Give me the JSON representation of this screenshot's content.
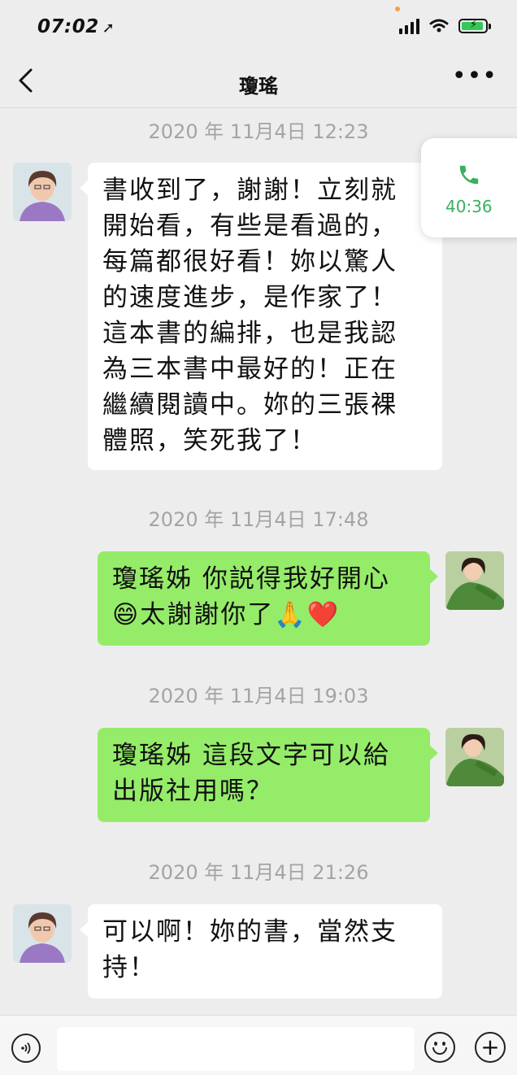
{
  "status_bar": {
    "time": "07:02",
    "location_arrow": "➚",
    "wifi_icon": "wifi-icon",
    "battery_state": "charging"
  },
  "nav": {
    "back_label": "‹",
    "title": "瓊瑤",
    "more_label": "•••"
  },
  "call_widget": {
    "duration": "40:36",
    "icon": "phone-icon",
    "color": "#38b15f"
  },
  "messages": [
    {
      "timestamp": "2020 年 11月4日 12:23",
      "side": "left",
      "lines": [
        "書收到了，謝謝！立刻就",
        "開始看，有些是看過的，",
        "每篇都很好看！妳以驚人",
        "的速度進步，是作家了！",
        "這本書的編排，也是我認",
        "為三本書中最好的！正在",
        "繼續閱讀中。妳的三張裸",
        "體照，笑死我了！"
      ]
    },
    {
      "timestamp": "2020 年 11月4日 17:48",
      "side": "right",
      "lines": [
        "瓊瑤姊 你説得我好開心",
        "😄太謝謝你了🙏❤️"
      ]
    },
    {
      "timestamp": "2020 年 11月4日 19:03",
      "side": "right",
      "lines": [
        "瓊瑤姊 這段文字可以給",
        "出版社用嗎？"
      ]
    },
    {
      "timestamp": "2020 年 11月4日 21:26",
      "side": "left",
      "lines": [
        "可以啊！妳的書，當然支",
        "持！"
      ]
    }
  ],
  "input_bar": {
    "voice_icon": "voice-icon",
    "emoji_icon": "emoji-icon",
    "plus_label": "+",
    "input_value": ""
  },
  "colors": {
    "background": "#ededed",
    "sent_bubble": "#95ec69",
    "received_bubble": "#ffffff",
    "timestamp": "#a4a4a4"
  }
}
